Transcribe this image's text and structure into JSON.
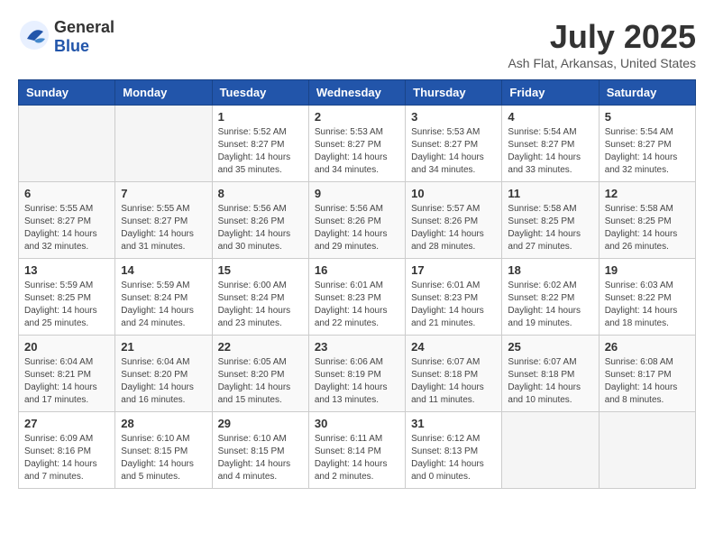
{
  "header": {
    "logo": {
      "general": "General",
      "blue": "Blue"
    },
    "title": "July 2025",
    "subtitle": "Ash Flat, Arkansas, United States"
  },
  "calendar": {
    "headers": [
      "Sunday",
      "Monday",
      "Tuesday",
      "Wednesday",
      "Thursday",
      "Friday",
      "Saturday"
    ],
    "weeks": [
      [
        {
          "day": "",
          "info": ""
        },
        {
          "day": "",
          "info": ""
        },
        {
          "day": "1",
          "info": "Sunrise: 5:52 AM\nSunset: 8:27 PM\nDaylight: 14 hours and 35 minutes."
        },
        {
          "day": "2",
          "info": "Sunrise: 5:53 AM\nSunset: 8:27 PM\nDaylight: 14 hours and 34 minutes."
        },
        {
          "day": "3",
          "info": "Sunrise: 5:53 AM\nSunset: 8:27 PM\nDaylight: 14 hours and 34 minutes."
        },
        {
          "day": "4",
          "info": "Sunrise: 5:54 AM\nSunset: 8:27 PM\nDaylight: 14 hours and 33 minutes."
        },
        {
          "day": "5",
          "info": "Sunrise: 5:54 AM\nSunset: 8:27 PM\nDaylight: 14 hours and 32 minutes."
        }
      ],
      [
        {
          "day": "6",
          "info": "Sunrise: 5:55 AM\nSunset: 8:27 PM\nDaylight: 14 hours and 32 minutes."
        },
        {
          "day": "7",
          "info": "Sunrise: 5:55 AM\nSunset: 8:27 PM\nDaylight: 14 hours and 31 minutes."
        },
        {
          "day": "8",
          "info": "Sunrise: 5:56 AM\nSunset: 8:26 PM\nDaylight: 14 hours and 30 minutes."
        },
        {
          "day": "9",
          "info": "Sunrise: 5:56 AM\nSunset: 8:26 PM\nDaylight: 14 hours and 29 minutes."
        },
        {
          "day": "10",
          "info": "Sunrise: 5:57 AM\nSunset: 8:26 PM\nDaylight: 14 hours and 28 minutes."
        },
        {
          "day": "11",
          "info": "Sunrise: 5:58 AM\nSunset: 8:25 PM\nDaylight: 14 hours and 27 minutes."
        },
        {
          "day": "12",
          "info": "Sunrise: 5:58 AM\nSunset: 8:25 PM\nDaylight: 14 hours and 26 minutes."
        }
      ],
      [
        {
          "day": "13",
          "info": "Sunrise: 5:59 AM\nSunset: 8:25 PM\nDaylight: 14 hours and 25 minutes."
        },
        {
          "day": "14",
          "info": "Sunrise: 5:59 AM\nSunset: 8:24 PM\nDaylight: 14 hours and 24 minutes."
        },
        {
          "day": "15",
          "info": "Sunrise: 6:00 AM\nSunset: 8:24 PM\nDaylight: 14 hours and 23 minutes."
        },
        {
          "day": "16",
          "info": "Sunrise: 6:01 AM\nSunset: 8:23 PM\nDaylight: 14 hours and 22 minutes."
        },
        {
          "day": "17",
          "info": "Sunrise: 6:01 AM\nSunset: 8:23 PM\nDaylight: 14 hours and 21 minutes."
        },
        {
          "day": "18",
          "info": "Sunrise: 6:02 AM\nSunset: 8:22 PM\nDaylight: 14 hours and 19 minutes."
        },
        {
          "day": "19",
          "info": "Sunrise: 6:03 AM\nSunset: 8:22 PM\nDaylight: 14 hours and 18 minutes."
        }
      ],
      [
        {
          "day": "20",
          "info": "Sunrise: 6:04 AM\nSunset: 8:21 PM\nDaylight: 14 hours and 17 minutes."
        },
        {
          "day": "21",
          "info": "Sunrise: 6:04 AM\nSunset: 8:20 PM\nDaylight: 14 hours and 16 minutes."
        },
        {
          "day": "22",
          "info": "Sunrise: 6:05 AM\nSunset: 8:20 PM\nDaylight: 14 hours and 15 minutes."
        },
        {
          "day": "23",
          "info": "Sunrise: 6:06 AM\nSunset: 8:19 PM\nDaylight: 14 hours and 13 minutes."
        },
        {
          "day": "24",
          "info": "Sunrise: 6:07 AM\nSunset: 8:18 PM\nDaylight: 14 hours and 11 minutes."
        },
        {
          "day": "25",
          "info": "Sunrise: 6:07 AM\nSunset: 8:18 PM\nDaylight: 14 hours and 10 minutes."
        },
        {
          "day": "26",
          "info": "Sunrise: 6:08 AM\nSunset: 8:17 PM\nDaylight: 14 hours and 8 minutes."
        }
      ],
      [
        {
          "day": "27",
          "info": "Sunrise: 6:09 AM\nSunset: 8:16 PM\nDaylight: 14 hours and 7 minutes."
        },
        {
          "day": "28",
          "info": "Sunrise: 6:10 AM\nSunset: 8:15 PM\nDaylight: 14 hours and 5 minutes."
        },
        {
          "day": "29",
          "info": "Sunrise: 6:10 AM\nSunset: 8:15 PM\nDaylight: 14 hours and 4 minutes."
        },
        {
          "day": "30",
          "info": "Sunrise: 6:11 AM\nSunset: 8:14 PM\nDaylight: 14 hours and 2 minutes."
        },
        {
          "day": "31",
          "info": "Sunrise: 6:12 AM\nSunset: 8:13 PM\nDaylight: 14 hours and 0 minutes."
        },
        {
          "day": "",
          "info": ""
        },
        {
          "day": "",
          "info": ""
        }
      ]
    ]
  }
}
